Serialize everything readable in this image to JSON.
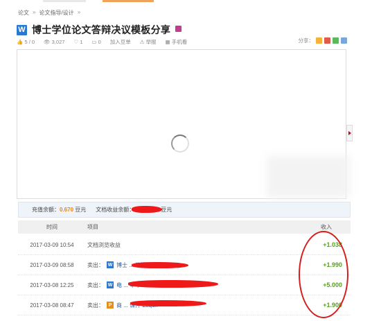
{
  "breadcrumb": {
    "home": "论文",
    "sep1": "»",
    "category": "论文指导/设计",
    "sep2": "»"
  },
  "document": {
    "file_type_label": "W",
    "title": "博士学位论文答辩决议模板分享"
  },
  "meta": {
    "rating": "5 / 0",
    "views": "3,027",
    "likes": "1",
    "comments": "0",
    "add_label": "加入豆单",
    "report_label": "举报",
    "mobile_label": "手机看"
  },
  "share": {
    "label": "分享："
  },
  "account": {
    "recharge_label": "充值余额：",
    "recharge_value": "0.670",
    "recharge_unit": "豆元",
    "earn_label": "文档收益余额：",
    "earn_unit": "豆元"
  },
  "table": {
    "headers": {
      "time": "时间",
      "item": "项目",
      "income": "收入"
    },
    "rows": [
      {
        "time": "2017-03-09 10:54",
        "prefix": "",
        "icon": "",
        "item": "文档浏览收益",
        "income": "+1.038"
      },
      {
        "time": "2017-03-09 08:58",
        "prefix": "卖出：",
        "icon": "W",
        "item": "博士 ... 议模板分享",
        "income": "+1.990"
      },
      {
        "time": "2017-03-08 12:25",
        "prefix": "卖出：",
        "icon": "W",
        "item": "电 ... 本中..",
        "income": "+5.000"
      },
      {
        "time": "2017-03-08 08:47",
        "prefix": "卖出：",
        "icon": "P",
        "item": "商 ... 课件 Etiqu..",
        "income": "+1.900"
      }
    ]
  },
  "colors": {
    "accent_blue": "#2b78d0",
    "income_green": "#5a9e24",
    "orange": "#f08300",
    "annotation_red": "#d51d1d"
  }
}
